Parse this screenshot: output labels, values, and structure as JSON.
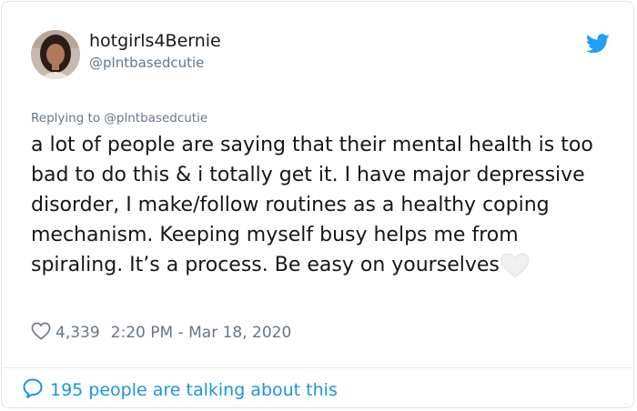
{
  "tweet": {
    "author": {
      "display_name": "hotgirls4Bernie",
      "handle": "@plntbasedcutie",
      "avatar_icon": "user-avatar-photo"
    },
    "brand_icon": "twitter-bird-icon",
    "brand_color": "#1da1f2",
    "reply_context": "Replying to @plntbasedcutie",
    "text": "a lot of people are saying that their mental health is too bad to do this & i totally get it. I have major depressive disorder, I make/follow routines as a healthy coping mechanism. Keeping myself busy helps me from spiraling. It’s a process. Be easy on yourselves",
    "text_emoji": "white-heart-emoji",
    "likes": "4,339",
    "timestamp": "2:20 PM - Mar 18, 2020",
    "conversation": "195 people are talking about this"
  },
  "colors": {
    "text": "#14171a",
    "secondary_text": "#657786",
    "link": "#1b95e0",
    "border": "#dfe3e6"
  }
}
